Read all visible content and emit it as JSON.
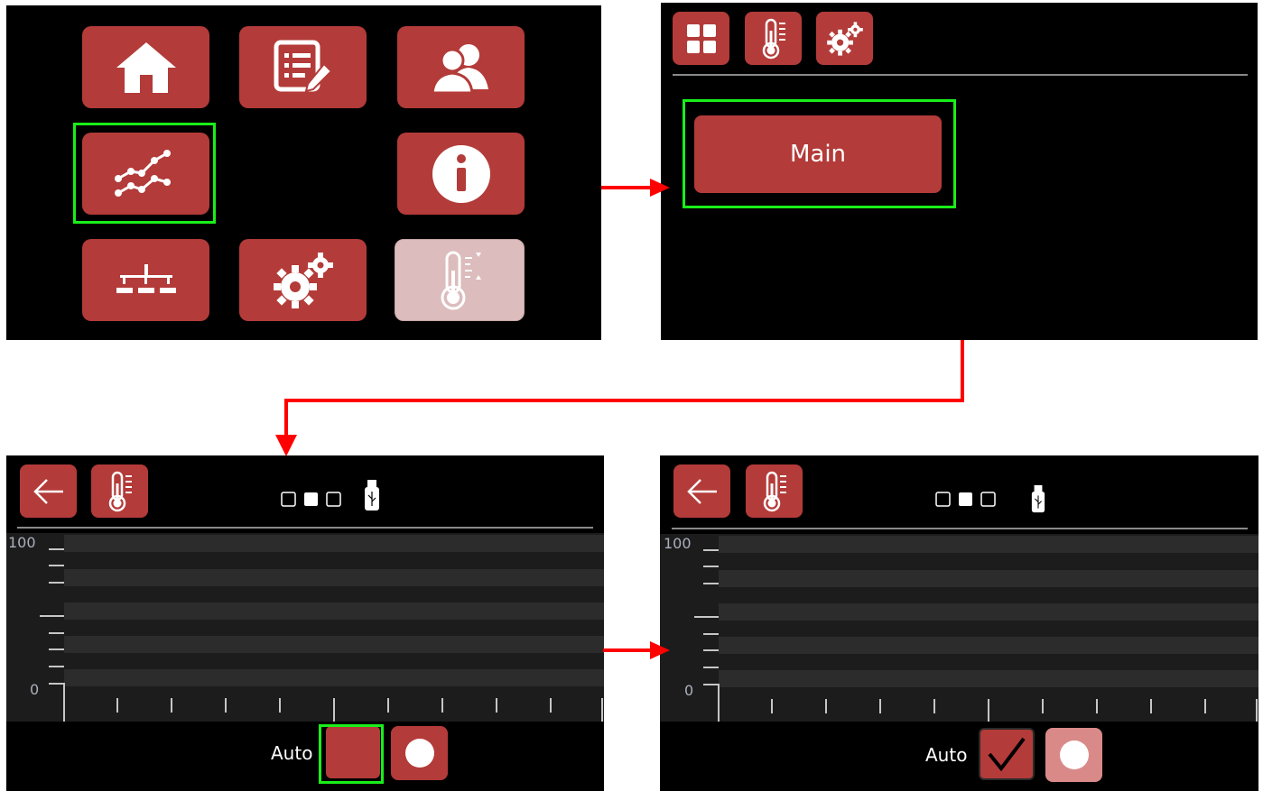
{
  "colors": {
    "tile": "#b33b39",
    "tile_disabled": "#dcbcbc",
    "highlight": "#19ef19",
    "arrow": "#ff0000",
    "screen_bg": "#000000"
  },
  "screen1": {
    "tiles": [
      {
        "icon": "home-icon"
      },
      {
        "icon": "list-edit-icon"
      },
      {
        "icon": "users-icon"
      },
      {
        "icon": "trend-chart-icon"
      },
      {
        "icon": "info-icon"
      },
      {
        "icon": "network-icon"
      },
      {
        "icon": "gears-icon"
      },
      {
        "icon": "thermometer-scale-icon",
        "disabled": true
      }
    ],
    "highlighted": "trend-chart-icon"
  },
  "screen2": {
    "toolbar": [
      "grid-icon",
      "thermometer-icon",
      "gears-icon"
    ],
    "main_label": "Main"
  },
  "screen3": {
    "y_top": "100",
    "y_bottom": "0",
    "auto_label": "Auto",
    "page_dots": 3,
    "active_dot": 1,
    "auto_checked": false
  },
  "screen4": {
    "y_top": "100",
    "y_bottom": "0",
    "auto_label": "Auto",
    "page_dots": 3,
    "active_dot": 1,
    "auto_checked": true
  }
}
